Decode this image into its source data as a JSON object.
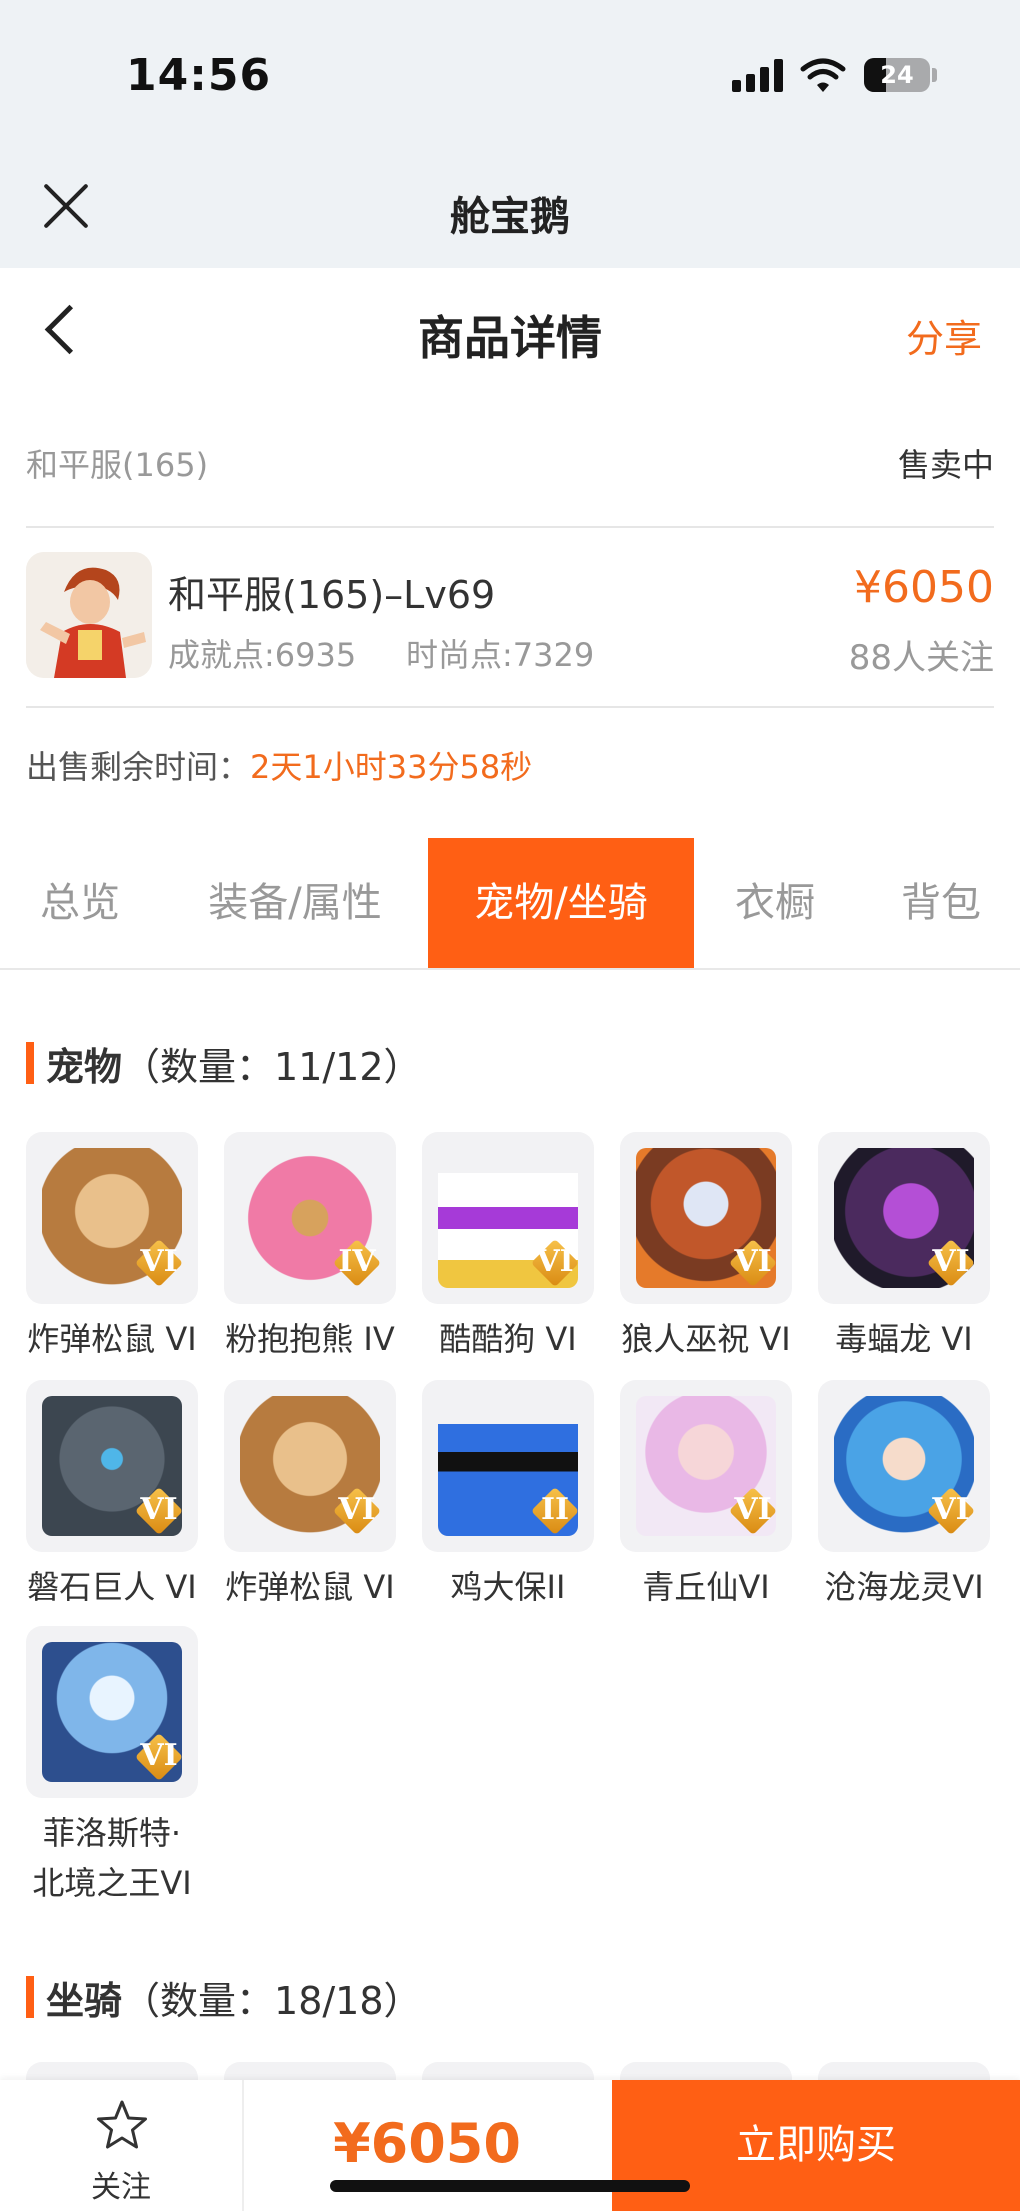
{
  "status_bar": {
    "time": "14:56",
    "battery": "24"
  },
  "app_bar": {
    "title": "舱宝鹅"
  },
  "page_header": {
    "title": "商品详情",
    "share_label": "分享"
  },
  "server": {
    "name": "和平服(165)",
    "status": "售卖中"
  },
  "product": {
    "name": "和平服(165)–Lv69",
    "achievement": "成就点:6935",
    "fashion": "时尚点:7329",
    "price": "¥6050",
    "followers": "88人关注"
  },
  "sale_time": {
    "label": "出售剩余时间：",
    "value": "2天1小时33分58秒"
  },
  "tabs": [
    "总览",
    "装备/属性",
    "宠物/坐骑",
    "衣橱",
    "背包"
  ],
  "active_tab": "宠物/坐骑",
  "pets_section": {
    "name": "宠物",
    "count": "（数量：11/12）"
  },
  "pets": [
    {
      "name": "炸弹松鼠 VI",
      "level": "VI"
    },
    {
      "name": "粉抱抱熊 IV",
      "level": "IV"
    },
    {
      "name": "酷酷狗 VI",
      "level": "VI"
    },
    {
      "name": "狼人巫祝 VI",
      "level": "VI"
    },
    {
      "name": "毒蝠龙 VI",
      "level": "VI"
    },
    {
      "name": "磐石巨人 VI",
      "level": "VI"
    },
    {
      "name": "炸弹松鼠 VI",
      "level": "VI"
    },
    {
      "name": "鸡大保II",
      "level": "II"
    },
    {
      "name": "青丘仙VI",
      "level": "VI"
    },
    {
      "name": "沧海龙灵VI",
      "level": "VI"
    },
    {
      "name": "菲洛斯特·\n北境之王VI",
      "level": "VI"
    }
  ],
  "mounts_section": {
    "name": "坐骑",
    "count": "（数量：18/18）"
  },
  "bottom_bar": {
    "follow_label": "关注",
    "price": "¥6050",
    "buy_label": "立即购买"
  },
  "colors": {
    "accent": "#ff5f14",
    "price": "#f26b1d",
    "badge": "#e9a52a"
  }
}
